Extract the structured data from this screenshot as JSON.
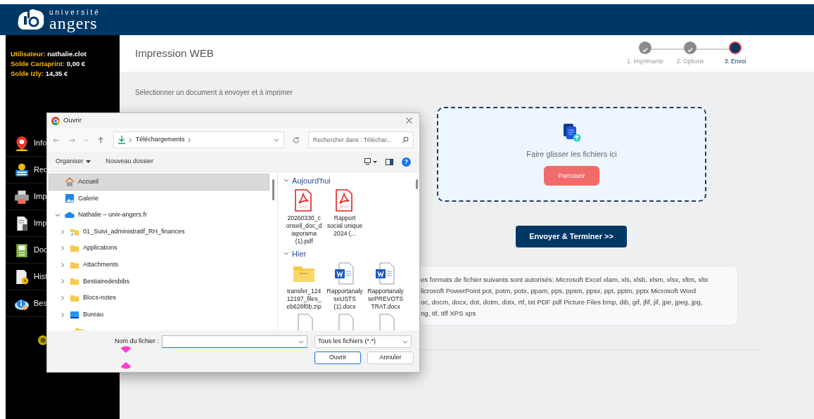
{
  "logo": {
    "line1": "université",
    "line2": "angers"
  },
  "user_info": [
    {
      "label": "Utilisateur:",
      "value": "nathalie.clot"
    },
    {
      "label": "Solde Cartaprint:",
      "value": "0,00 €"
    },
    {
      "label": "Solde Izly:",
      "value": "14,35 €"
    }
  ],
  "sidebar": {
    "items": [
      {
        "label": "Info"
      },
      {
        "label": "Rec"
      },
      {
        "label": "Imp"
      },
      {
        "label": "Imp"
      },
      {
        "label": "Doc"
      },
      {
        "label": "Hist"
      },
      {
        "label": "Bes"
      }
    ]
  },
  "page": {
    "title": "Impression WEB",
    "steps": [
      {
        "label": "1. Imprimante",
        "completed": true,
        "selected": false
      },
      {
        "label": "2. Options",
        "completed": true,
        "selected": false
      },
      {
        "label": "3. Envoi",
        "completed": false,
        "selected": true
      }
    ],
    "instruction": "Sélectionner un document à envoyer et à imprimer",
    "dropzone": {
      "text": "Faire glisser les fichiers ici",
      "button": "Parcourir"
    },
    "submit_button": "Envoyer & Terminer >>",
    "formats_lines": [
      "es formats de fichier suivants sont autorisés: Microsoft Excel xlam, xls, xlsb, xlsm, xlsx, xltm, xltx",
      "licrosoft PowerPoint pot, potm, potx, ppam, pps, ppsm, ppsx, ppt, pptm, pptx Microsoft Word",
      "oc, docm, docx, dot, dotm, dotx, rtf, txt PDF pdf Picture Files bmp, dib, gif, jfif, jif, jpe, jpeg, jpg,",
      "ng, tif, tiff XPS xps"
    ]
  },
  "dialog": {
    "title": "Ouvrir",
    "address": "Téléchargements",
    "search_placeholder": "Rechercher dans : Téléchar...",
    "commands": [
      "Organiser",
      "Nouveau dossier"
    ],
    "help": "?",
    "nav": [
      {
        "label": "Accueil",
        "kind": "home",
        "selected": true
      },
      {
        "label": "Galerie",
        "kind": "gallery",
        "selected": false
      },
      {
        "label": "Nathalie – univ-angers.fr",
        "kind": "cloud",
        "selected": false,
        "expanded": true,
        "children": [
          {
            "label": "01_Suivi_administratif_RH_finances",
            "kind": "shared-folder",
            "selected": false,
            "expanded": false
          },
          {
            "label": "Applications",
            "kind": "folder",
            "selected": false,
            "expanded": false
          },
          {
            "label": "Attachments",
            "kind": "folder",
            "selected": false,
            "expanded": false
          },
          {
            "label": "Bestiairedesbibs",
            "kind": "folder",
            "selected": false,
            "expanded": false
          },
          {
            "label": "Blocs-notes",
            "kind": "folder",
            "selected": false,
            "expanded": false
          },
          {
            "label": "Bureau",
            "kind": "desktop",
            "selected": false,
            "expanded": false
          }
        ]
      }
    ],
    "groups": [
      {
        "title": "Aujourd'hui",
        "expanded": true,
        "files": [
          {
            "name": "20260330_conseil_doc_diaporama (1).pdf",
            "kind": "pdf"
          },
          {
            "name": "Rapport social unique 2024 (...",
            "kind": "pdf"
          }
        ]
      },
      {
        "title": "Hier",
        "expanded": true,
        "files": [
          {
            "name": "transfer_12412197_files_eb628f0b.zip",
            "kind": "zip"
          },
          {
            "name": "RapportanalyseUSTS (1).docx",
            "kind": "word"
          },
          {
            "name": "RapportanalysePREVOTSTRAT.docx",
            "kind": "word"
          }
        ]
      }
    ],
    "filename_label": "Nom du fichier :",
    "filetype": "Tous les fichiers (*.*)",
    "buttons": [
      {
        "label": "Ouvrir",
        "default": true
      },
      {
        "label": "Annuler",
        "default": false
      }
    ]
  }
}
